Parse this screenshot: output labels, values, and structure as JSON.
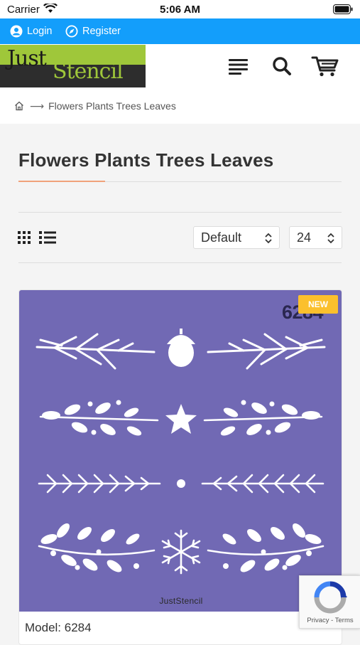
{
  "status_bar": {
    "carrier": "Carrier",
    "time": "5:06 AM"
  },
  "top_bar": {
    "login_label": "Login",
    "register_label": "Register"
  },
  "header": {
    "logo_text_just": "Just",
    "logo_text_stencil": "Stencil"
  },
  "breadcrumb": {
    "current": "Flowers Plants Trees Leaves"
  },
  "page": {
    "title": "Flowers Plants Trees Leaves"
  },
  "toolbar": {
    "sort_value": "Default",
    "limit_value": "24"
  },
  "product": {
    "number": "6284",
    "badge": "NEW",
    "brand": "JustStencil",
    "model": "Model: 6284"
  },
  "recaptcha": {
    "text": "Privacy - Terms"
  },
  "colors": {
    "top_bar": "#139efb",
    "logo_green": "#9fc73a",
    "stencil_bg": "#7169b4",
    "badge": "#fbc02d",
    "title_accent": "#f0a27a"
  }
}
